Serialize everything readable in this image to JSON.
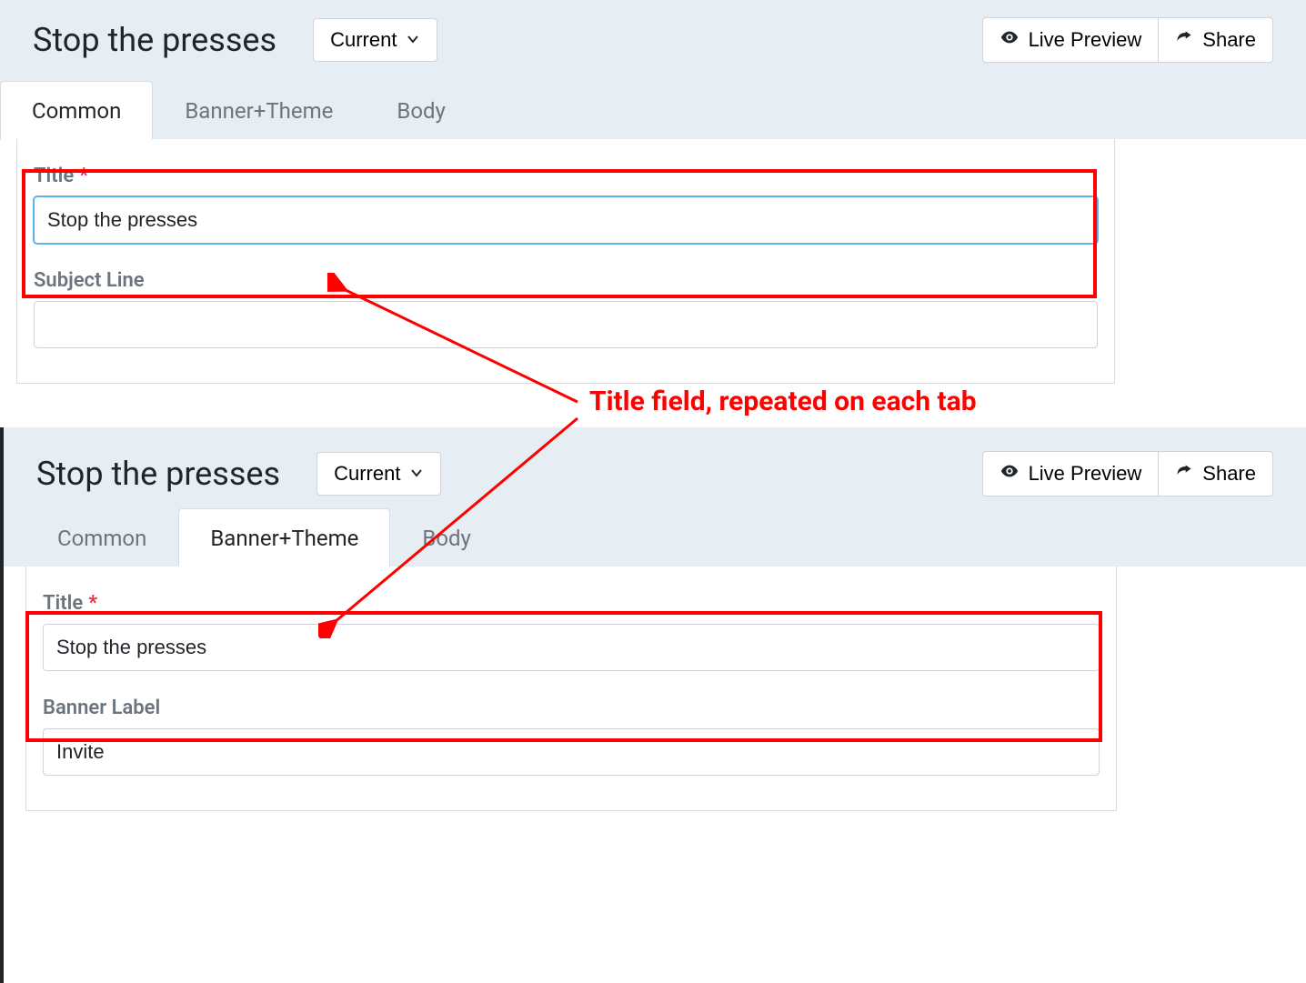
{
  "annotation": {
    "text": "Title field, repeated on each tab"
  },
  "screenshots": [
    {
      "header": {
        "title": "Stop the presses",
        "version_selector": "Current",
        "live_preview": "Live Preview",
        "share": "Share"
      },
      "tabs": {
        "common": "Common",
        "banner": "Banner+Theme",
        "body": "Body",
        "active": "common"
      },
      "form": {
        "title_label": "Title",
        "title_value": "Stop the presses",
        "subject_label": "Subject Line",
        "subject_value": ""
      }
    },
    {
      "header": {
        "title": "Stop the presses",
        "version_selector": "Current",
        "live_preview": "Live Preview",
        "share": "Share"
      },
      "tabs": {
        "common": "Common",
        "banner": "Banner+Theme",
        "body": "Body",
        "active": "banner"
      },
      "form": {
        "title_label": "Title",
        "title_value": "Stop the presses",
        "banner_label": "Banner Label",
        "banner_value": "Invite"
      }
    }
  ]
}
